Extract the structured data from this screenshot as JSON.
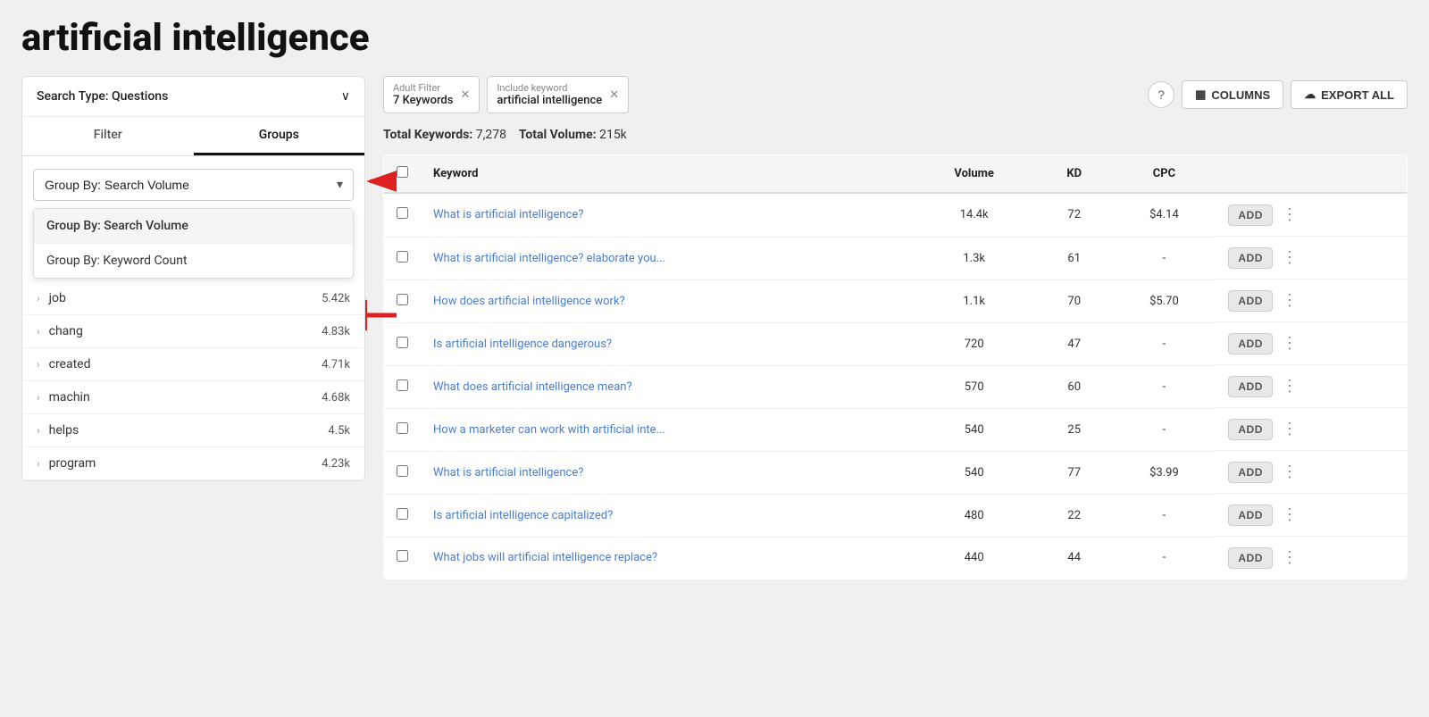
{
  "page": {
    "title": "artificial intelligence"
  },
  "sidebar": {
    "search_type_label": "Search Type: Questions",
    "chevron": "∨",
    "tabs": [
      {
        "id": "filter",
        "label": "Filter",
        "active": false
      },
      {
        "id": "groups",
        "label": "Groups",
        "active": true
      }
    ],
    "group_by": {
      "current": "Group By: Search Volume",
      "options": [
        {
          "label": "Group By: Search Volume",
          "selected": true
        },
        {
          "label": "Group By: Keyword Count",
          "selected": false
        }
      ]
    },
    "list_items": [
      {
        "label": "job",
        "count": "5.42k"
      },
      {
        "label": "chang",
        "count": "4.83k"
      },
      {
        "label": "created",
        "count": "4.71k"
      },
      {
        "label": "machin",
        "count": "4.68k"
      },
      {
        "label": "helps",
        "count": "4.5k"
      },
      {
        "label": "program",
        "count": "4.23k"
      }
    ]
  },
  "filter_bar": {
    "chips": [
      {
        "id": "adult-filter",
        "label_small": "Adult Filter",
        "value": "7 Keywords",
        "has_close": true
      },
      {
        "id": "include-keyword",
        "label_small": "Include keyword",
        "value": "artificial intelligence",
        "has_close": true
      }
    ],
    "help_icon": "?",
    "columns_label": "COLUMNS",
    "export_label": "EXPORT ALL"
  },
  "stats": {
    "total_keywords_label": "Total Keywords:",
    "total_keywords_value": "7,278",
    "total_volume_label": "Total Volume:",
    "total_volume_value": "215k"
  },
  "table": {
    "columns": [
      {
        "id": "keyword",
        "label": "Keyword"
      },
      {
        "id": "volume",
        "label": "Volume"
      },
      {
        "id": "kd",
        "label": "KD"
      },
      {
        "id": "cpc",
        "label": "CPC"
      }
    ],
    "rows": [
      {
        "keyword": "What is artificial intelligence?",
        "volume": "14.4k",
        "kd": "72",
        "cpc": "$4.14"
      },
      {
        "keyword": "What is artificial intelligence? elaborate you...",
        "volume": "1.3k",
        "kd": "61",
        "cpc": "-"
      },
      {
        "keyword": "How does artificial intelligence work?",
        "volume": "1.1k",
        "kd": "70",
        "cpc": "$5.70"
      },
      {
        "keyword": "Is artificial intelligence dangerous?",
        "volume": "720",
        "kd": "47",
        "cpc": "-"
      },
      {
        "keyword": "What does artificial intelligence mean?",
        "volume": "570",
        "kd": "60",
        "cpc": "-"
      },
      {
        "keyword": "How a marketer can work with artificial inte...",
        "volume": "540",
        "kd": "25",
        "cpc": "-"
      },
      {
        "keyword": "What is artificial intelligence?",
        "volume": "540",
        "kd": "77",
        "cpc": "$3.99"
      },
      {
        "keyword": "Is artificial intelligence capitalized?",
        "volume": "480",
        "kd": "22",
        "cpc": "-"
      },
      {
        "keyword": "What jobs will artificial intelligence replace?",
        "volume": "440",
        "kd": "44",
        "cpc": "-"
      }
    ],
    "add_button_label": "ADD"
  }
}
